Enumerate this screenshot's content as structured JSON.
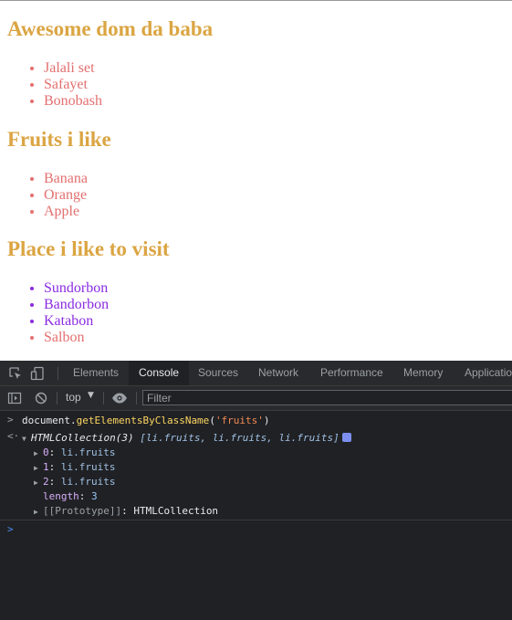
{
  "page": {
    "sections": [
      {
        "heading": "Awesome dom da baba",
        "items": [
          "Jalali set",
          "Safayet",
          "Bonobash"
        ]
      },
      {
        "heading": "Fruits i like",
        "items": [
          "Banana",
          "Orange",
          "Apple"
        ]
      },
      {
        "heading": "Place i like to visit",
        "items": [
          "Sundorbon",
          "Bandorbon",
          "Katabon",
          "Salbon"
        ]
      }
    ],
    "colors": {
      "heading": "#dba543",
      "item_red": "#e36f6f",
      "item_purple": "#8a2be2"
    }
  },
  "devtools": {
    "tabs": [
      "Elements",
      "Console",
      "Sources",
      "Network",
      "Performance",
      "Memory",
      "Applicatio"
    ],
    "active_tab": "Console",
    "toolbar": {
      "context": "top",
      "filter_placeholder": "Filter"
    },
    "console": {
      "input": {
        "object": "document",
        "method": "getElementsByClassName",
        "arg": "'fruits'"
      },
      "output": {
        "summary_type": "HTMLCollection(3)",
        "summary_items": "[li.fruits, li.fruits, li.fruits]",
        "entries": [
          {
            "key": "0",
            "value": "li.fruits"
          },
          {
            "key": "1",
            "value": "li.fruits"
          },
          {
            "key": "2",
            "value": "li.fruits"
          }
        ],
        "length_key": "length",
        "length_value": "3",
        "prototype_key": "[[Prototype]]",
        "prototype_value": "HTMLCollection"
      }
    },
    "icons": [
      "inspect-icon",
      "device-toggle-icon",
      "sidebar-toggle-icon",
      "clear-console-icon",
      "eye-icon"
    ]
  }
}
